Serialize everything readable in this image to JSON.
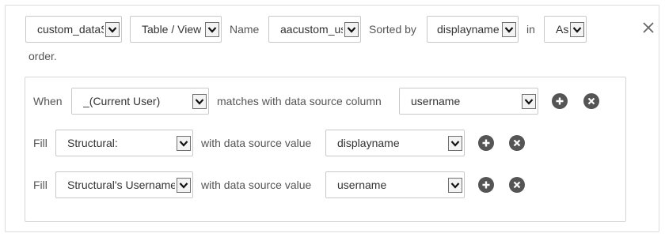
{
  "header": {
    "data_source": {
      "value": "custom_dataS"
    },
    "type": {
      "value": "Table / View"
    },
    "name_label": "Name",
    "name": {
      "value": "aacustom_us"
    },
    "sorted_by_label": "Sorted by",
    "sort_field": {
      "value": "displayname"
    },
    "in_label": "in",
    "sort_order": {
      "value": "As"
    },
    "order_label": "order."
  },
  "rules": {
    "when_row": {
      "label": "When",
      "select": "_(Current User)",
      "middle_text": "matches with data source column",
      "column": "username"
    },
    "fill_rows": [
      {
        "label": "Fill",
        "select": "Structural:",
        "middle_text": "with data source value",
        "column": "displayname"
      },
      {
        "label": "Fill",
        "select": "Structural's Username",
        "middle_text": "with data source value",
        "column": "username"
      }
    ]
  },
  "icons": {
    "close": "close-icon",
    "add": "plus-circle-icon",
    "remove": "x-circle-icon",
    "dropdown": "chevron-down-icon"
  },
  "colors": {
    "icon_dark": "#555555",
    "border": "#c9c9c9"
  }
}
